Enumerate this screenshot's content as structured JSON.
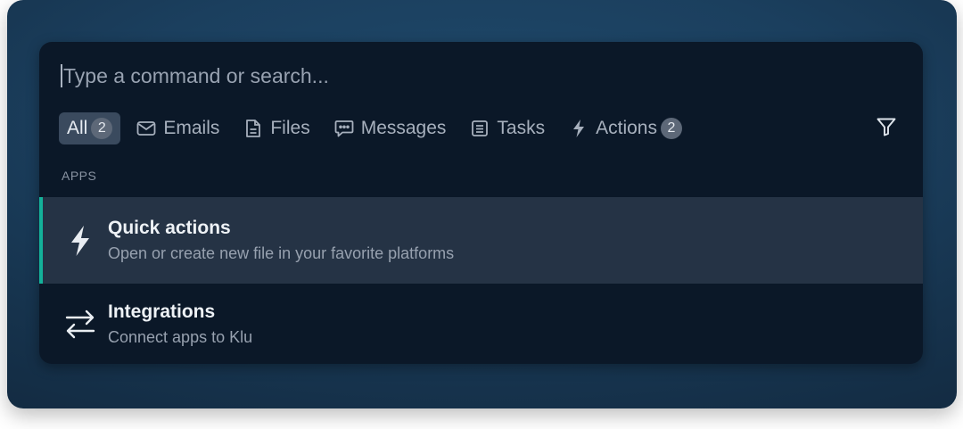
{
  "search": {
    "placeholder": "Type a command or search..."
  },
  "filters": [
    {
      "label": "All",
      "icon": "none",
      "badge": "2",
      "active": true
    },
    {
      "label": "Emails",
      "icon": "mail-icon",
      "badge": null,
      "active": false
    },
    {
      "label": "Files",
      "icon": "file-icon",
      "badge": null,
      "active": false
    },
    {
      "label": "Messages",
      "icon": "chat-icon",
      "badge": null,
      "active": false
    },
    {
      "label": "Tasks",
      "icon": "list-icon",
      "badge": null,
      "active": false
    },
    {
      "label": "Actions",
      "icon": "lightning-icon",
      "badge": "2",
      "active": false
    }
  ],
  "filter_button_icon": "funnel-icon",
  "section": {
    "label": "APPS"
  },
  "items": [
    {
      "title": "Quick actions",
      "subtitle": "Open or create new file in your favorite platforms",
      "icon": "lightning-icon",
      "selected": true
    },
    {
      "title": "Integrations",
      "subtitle": "Connect apps to Klu",
      "icon": "arrows-exchange-icon",
      "selected": false
    }
  ],
  "colors": {
    "accent": "#14b29a",
    "panel": "#0b1828",
    "selected_row": "#253345"
  }
}
